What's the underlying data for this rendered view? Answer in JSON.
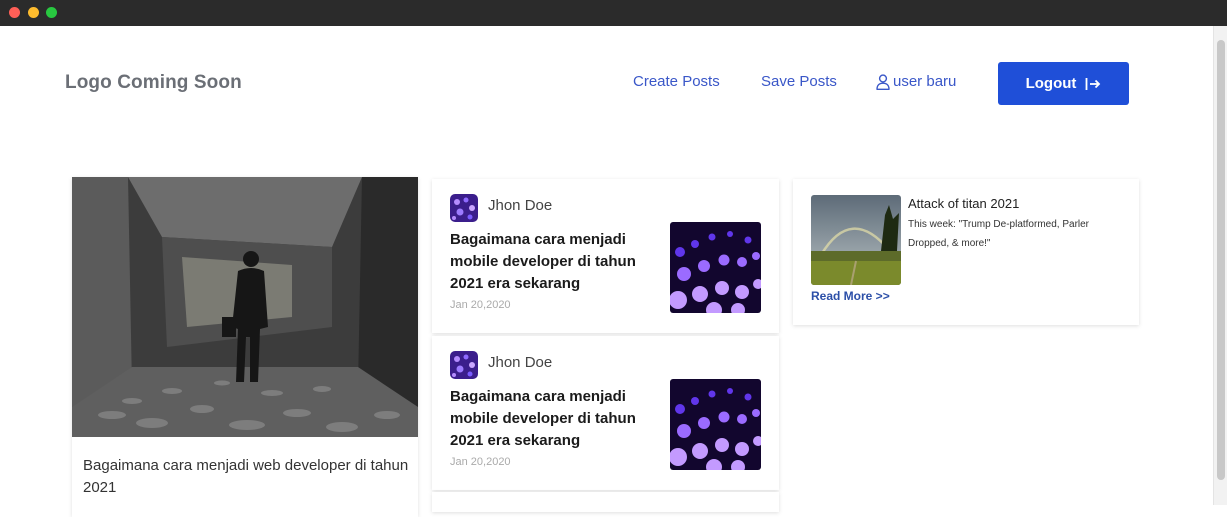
{
  "window": {
    "controls": [
      "close",
      "minimize",
      "maximize"
    ]
  },
  "header": {
    "logo": "Logo Coming Soon",
    "nav": {
      "create": "Create Posts",
      "save": "Save Posts",
      "user": "user baru",
      "logout": "Logout"
    }
  },
  "featured": {
    "title": "Bagaimana cara menjadi web developer di tahun 2021"
  },
  "posts": [
    {
      "author": "Jhon Doe",
      "title": "Bagaimana cara menjadi mobile developer di tahun 2021 era sekarang",
      "date": "Jan 20,2020"
    },
    {
      "author": "Jhon Doe",
      "title": "Bagaimana cara menjadi mobile developer di tahun 2021 era sekarang",
      "date": "Jan 20,2020"
    }
  ],
  "side": {
    "title": "Attack of titan 2021",
    "description": "This week: \"Trump De-platformed, Parler Dropped, & more!\"",
    "read_more": "Read More >>"
  },
  "colors": {
    "accent": "#1f4fd8",
    "nav_link": "#3a57c8",
    "logo": "#6b6f76"
  }
}
